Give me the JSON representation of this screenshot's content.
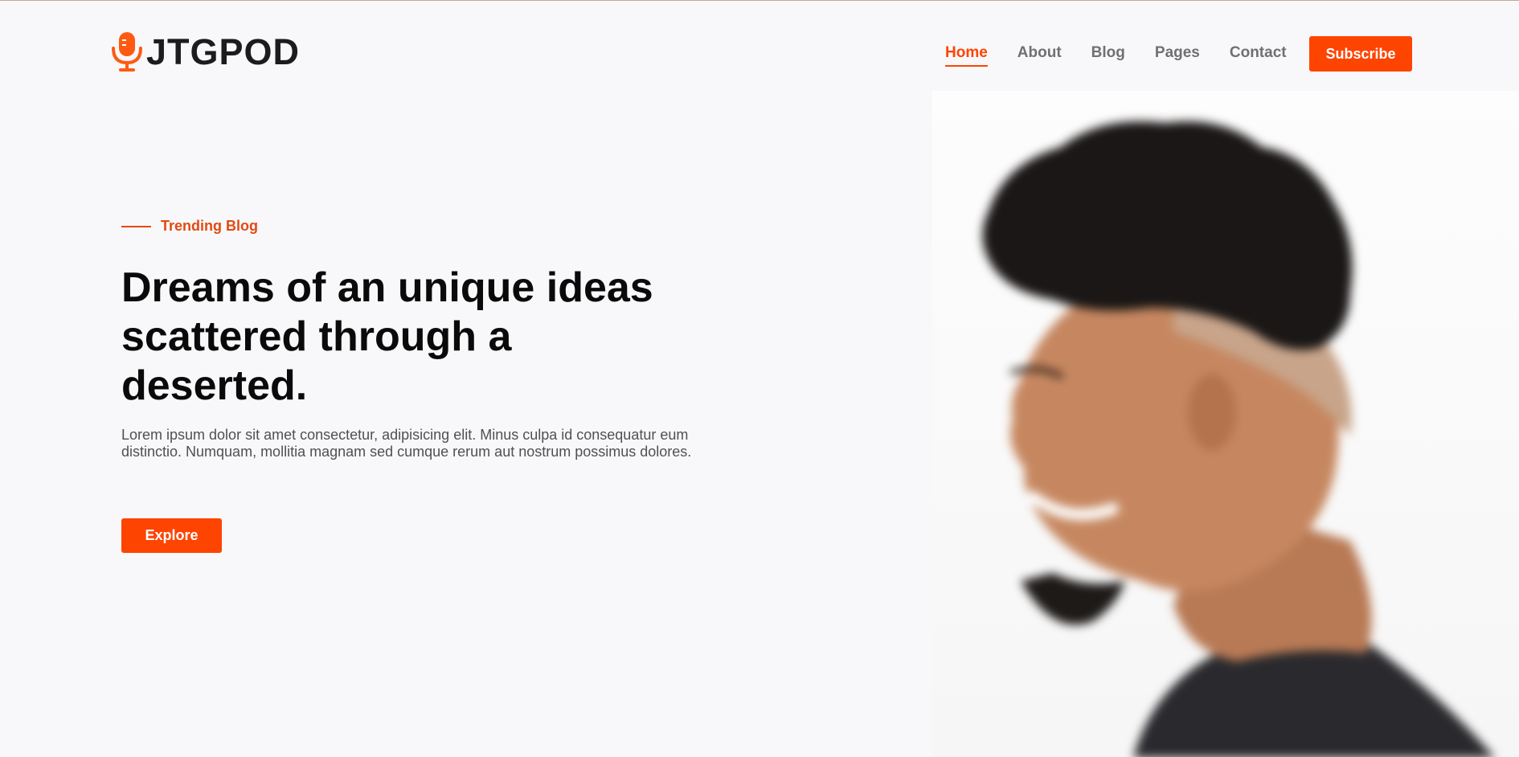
{
  "brand": {
    "name": "JTGPOD",
    "accent_color": "#fe4401",
    "icon": "microphone-icon"
  },
  "nav": {
    "items": [
      {
        "label": "Home",
        "active": true
      },
      {
        "label": "About",
        "active": false
      },
      {
        "label": "Blog",
        "active": false
      },
      {
        "label": "Pages",
        "active": false
      },
      {
        "label": "Contact",
        "active": false
      }
    ],
    "subscribe_label": "Subscribe"
  },
  "hero": {
    "eyebrow": "Trending Blog",
    "headline": "Dreams of an unique ideas scattered through a deserted.",
    "description": "Lorem ipsum dolor sit amet consectetur, adipisicing elit. Minus culpa id consequatur eum distinctio. Numquam, mollitia magnam sed cumque rerum aut nostrum possimus dolores.",
    "cta_label": "Explore"
  }
}
